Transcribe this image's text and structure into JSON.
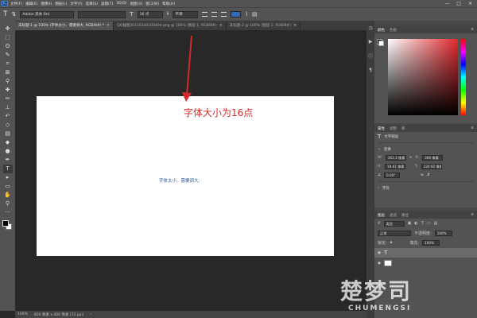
{
  "app": {
    "logo": "Ps"
  },
  "menubar": {
    "items": [
      "文件(F)",
      "编辑(E)",
      "图像(I)",
      "图层(L)",
      "文字(Y)",
      "选择(S)",
      "滤镜(T)",
      "3D(D)",
      "视图(V)",
      "窗口(W)",
      "帮助(H)"
    ],
    "controls": [
      "—",
      "□",
      "✕"
    ]
  },
  "options_bar": {
    "font_family": "Adobe 黑体 Std",
    "font_style": "",
    "font_size": "16 点",
    "antialias": "平滑",
    "text_color": "#2e6bbd"
  },
  "tabs": [
    {
      "label": "未标题-1 @ 100% (字体太小、需要调大, RGB/8#) *",
      "active": true
    },
    {
      "label": "QQ截图20210330100404.png @ 100% (图层 1, RGB/8#)",
      "active": false
    },
    {
      "label": "未标题-2 @ 100% (图层 1, RGB/8#)",
      "active": false
    }
  ],
  "toolbar": {
    "tools": [
      "move-icon",
      "marquee-icon",
      "lasso-icon",
      "quick-select-icon",
      "crop-icon",
      "frame-icon",
      "eyedropper-icon",
      "healing-icon",
      "brush-icon",
      "stamp-icon",
      "history-brush-icon",
      "eraser-icon",
      "gradient-icon",
      "blur-icon",
      "dodge-icon",
      "pen-icon",
      "type-icon",
      "path-select-icon",
      "shape-icon",
      "hand-icon",
      "zoom-icon",
      "more-icon"
    ],
    "glyphs": [
      "✥",
      "⬚",
      "ʘ",
      "✎",
      "⌗",
      "⊠",
      "⚲",
      "✚",
      "✏",
      "⊥",
      "↶",
      "◇",
      "▤",
      "◆",
      "●",
      "✒",
      "T",
      "▸",
      "▭",
      "✋",
      "⚲",
      "···"
    ],
    "selected_index": 16
  },
  "canvas": {
    "layer_text": "字体太小、需要调大;",
    "annotation": "字体大小为16点",
    "annotation_color": "#d32b2b"
  },
  "status_bar": {
    "zoom": "100%",
    "doc_info": "800 像素 x 400 像素 (72 ppi)"
  },
  "color_panel": {
    "tabs": [
      "颜色",
      "色板"
    ]
  },
  "properties_panel": {
    "tabs": [
      "属性",
      "调整",
      "库"
    ],
    "layer_type": "文字图层",
    "section_transform": "变换",
    "w_label": "W:",
    "w_value": "163.3 像素",
    "x_label": "X:",
    "x_value": "306 像素",
    "h_label": "H:",
    "h_value": "18.61 像素",
    "y_label": "Y:",
    "y_value": "220.92 像素",
    "angle": "0.00°",
    "section_character": "字符"
  },
  "layers_panel": {
    "tabs": [
      "图层",
      "通道",
      "路径"
    ],
    "filter": "类型",
    "blend_mode": "正常",
    "opacity_label": "不透明度:",
    "opacity": "100%",
    "fill_label": "填充:",
    "fill": "100%",
    "lock_label": "锁定:"
  },
  "watermark": {
    "cn": "楚梦司",
    "en": "CHUMENGSI"
  }
}
